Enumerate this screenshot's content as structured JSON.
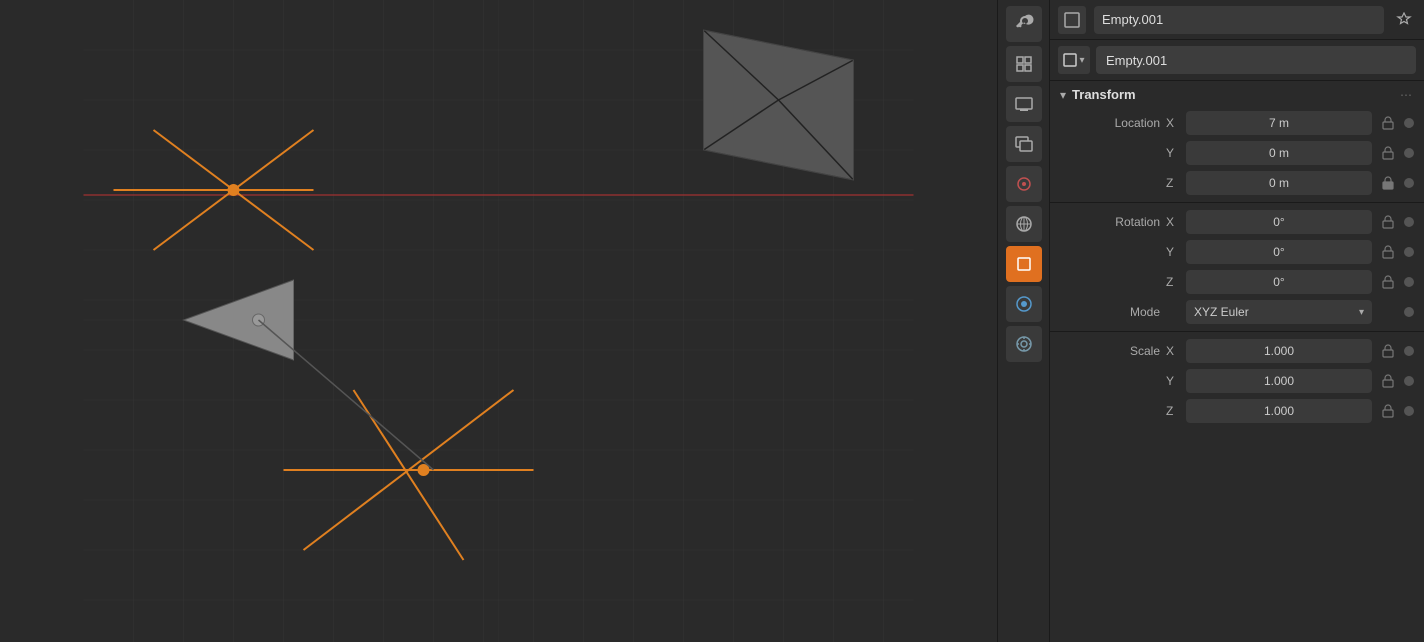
{
  "header": {
    "object_name": "Empty.001",
    "pin_icon": "📌",
    "object_type_icon": "□",
    "chevron": "▾"
  },
  "toolbar": {
    "icons": [
      {
        "name": "wrench-icon",
        "symbol": "🔧",
        "active": false
      },
      {
        "name": "scene-icon",
        "symbol": "🎬",
        "active": false
      },
      {
        "name": "output-icon",
        "symbol": "🖨",
        "active": false
      },
      {
        "name": "view-layer-icon",
        "symbol": "🖼",
        "active": false
      },
      {
        "name": "paint-icon",
        "symbol": "🎨",
        "active": false
      },
      {
        "name": "world-icon",
        "symbol": "🌍",
        "active": false
      },
      {
        "name": "object-icon",
        "symbol": "🟧",
        "active": true
      },
      {
        "name": "modifier-icon",
        "symbol": "🔵",
        "active": false
      },
      {
        "name": "particles-icon",
        "symbol": "⚙",
        "active": false
      }
    ]
  },
  "transform": {
    "section_title": "Transform",
    "location_label": "Location",
    "x_label": "X",
    "y_label": "Y",
    "z_label": "Z",
    "location_x": "7 m",
    "location_y": "0 m",
    "location_z": "0 m",
    "rotation_label": "Rotation",
    "rotation_x": "0°",
    "rotation_y": "0°",
    "rotation_z": "0°",
    "mode_label": "Mode",
    "mode_value": "XYZ Euler",
    "scale_label": "Scale",
    "scale_x": "1.000",
    "scale_y": "1.000",
    "scale_z": "1.000"
  },
  "colors": {
    "accent_orange": "#e07020",
    "bg_dark": "#2a2a2a",
    "bg_darker": "#1a1a1a",
    "bg_field": "#3a3a3a",
    "text_primary": "#dddddd",
    "text_secondary": "#aaaaaa"
  }
}
